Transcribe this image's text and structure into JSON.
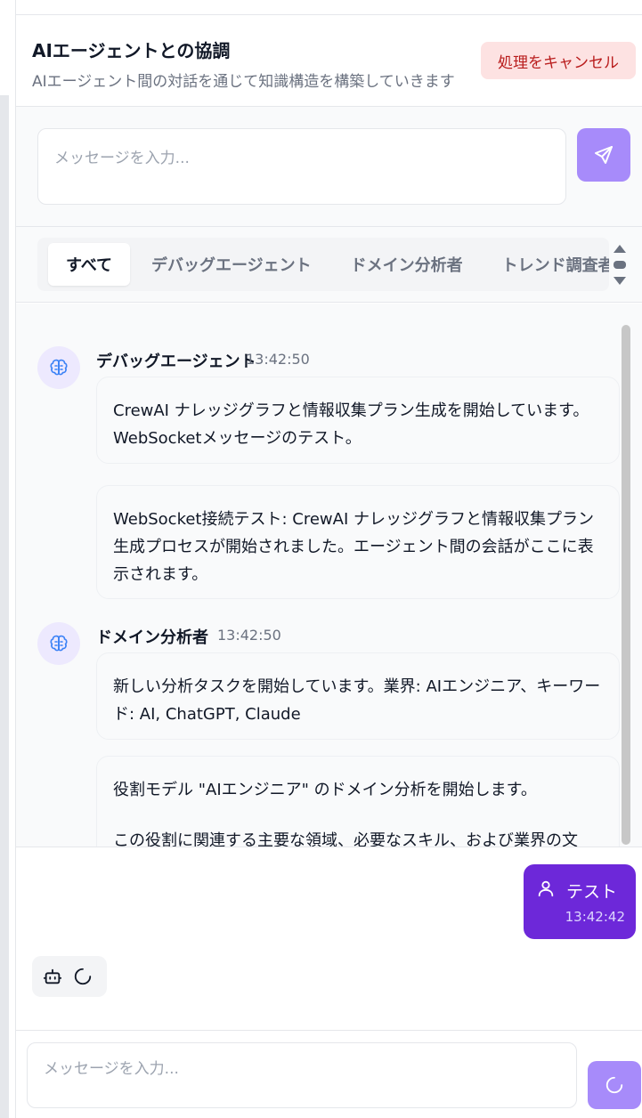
{
  "header": {
    "title": "AIエージェントとの協調",
    "subtitle": "AIエージェント間の対話を通じて知識構造を構築していきます",
    "cancel_label": "処理をキャンセル"
  },
  "compose_top": {
    "placeholder": "メッセージを入力..."
  },
  "tabs": [
    {
      "label": "すべて",
      "active": true
    },
    {
      "label": "デバッグエージェント",
      "active": false
    },
    {
      "label": "ドメイン分析者",
      "active": false
    },
    {
      "label": "トレンド調査者",
      "active": false
    }
  ],
  "messages": [
    {
      "agent": "デバッグエージェント",
      "time": "13:42:50",
      "bubbles": [
        "CrewAI ナレッジグラフと情報収集プラン生成を開始しています。WebSocketメッセージのテスト。",
        "WebSocket接続テスト: CrewAI ナレッジグラフと情報収集プラン生成プロセスが開始されました。エージェント間の会話がここに表示されます。"
      ]
    },
    {
      "agent": "ドメイン分析者",
      "time": "13:42:50",
      "bubbles": [
        "新しい分析タスクを開始しています。業界: AIエンジニア、キーワード: AI, ChatGPT, Claude",
        "役割モデル \"AIエンジニア\" のドメイン分析を開始します。",
        "この役割に関連する主要な領域、必要なスキル、および業界の文"
      ]
    }
  ],
  "chat": {
    "user_name": "テスト",
    "user_time": "13:42:42"
  },
  "footer": {
    "placeholder": "メッセージを入力..."
  },
  "colors": {
    "accent": "#6d28d9",
    "accent_light": "#a78bfa",
    "danger_bg": "#fde2e2",
    "danger_text": "#b91c1c"
  }
}
